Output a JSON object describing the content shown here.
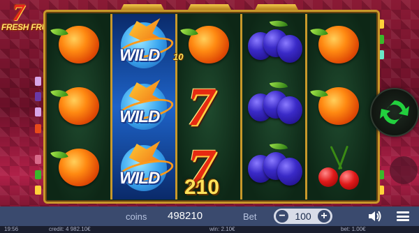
{
  "logo": {
    "seven": "7",
    "text": "FRESH FRUITS"
  },
  "reels": {
    "wild_label": "WILD",
    "seven_label": "7"
  },
  "wins": {
    "small_win": "10",
    "total_win": "210"
  },
  "bottom_bar": {
    "coins_label": "coins",
    "coins_value": "498210",
    "bet_label": "Bet",
    "bet_value": "100",
    "bet_minus": "−",
    "bet_plus": "+"
  },
  "status_bar": {
    "time": "19:56",
    "credit": "credit: 4 982.10€",
    "win": "win: 2.10€",
    "bet": "bet: 1.00€"
  },
  "colors": {
    "frame": "#c8982a",
    "bar": "#3a4a6e",
    "spin": "#1fc83a"
  }
}
